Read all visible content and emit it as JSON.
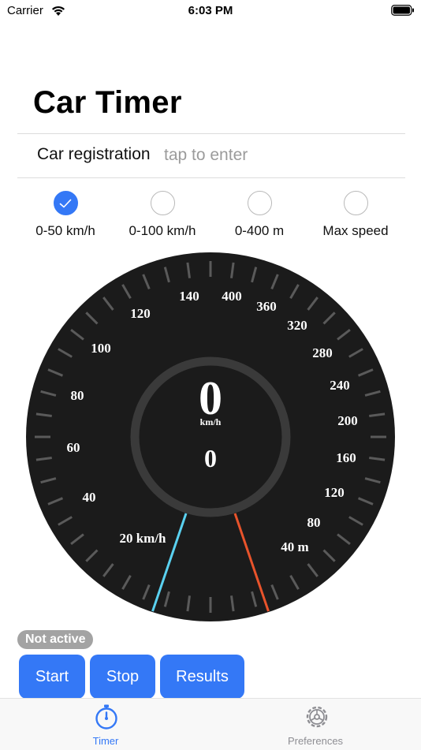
{
  "status_bar": {
    "carrier": "Carrier",
    "time": "6:03 PM"
  },
  "title": "Car Timer",
  "registration": {
    "label": "Car registration",
    "placeholder": "tap to enter",
    "value": ""
  },
  "modes": [
    {
      "label": "0-50 km/h",
      "selected": true
    },
    {
      "label": "0-100 km/h",
      "selected": false
    },
    {
      "label": "0-400 m",
      "selected": false
    },
    {
      "label": "Max speed",
      "selected": false
    }
  ],
  "gauge": {
    "speed_value": "0",
    "speed_unit": "km/h",
    "secondary_value": "0",
    "left_scale": [
      "20 km/h",
      "40",
      "60",
      "80",
      "100",
      "120",
      "140"
    ],
    "right_scale": [
      "400",
      "360",
      "320",
      "280",
      "240",
      "200",
      "160",
      "120",
      "80",
      "40 m"
    ],
    "colors": {
      "face": "#1b1b1b",
      "ring": "#3a3a3a",
      "speed_needle": "#5ad1f0",
      "distance_needle": "#e8532b"
    }
  },
  "status_badge": "Not active",
  "buttons": {
    "start": "Start",
    "stop": "Stop",
    "results": "Results"
  },
  "tabs": [
    {
      "label": "Timer",
      "active": true,
      "icon": "stopwatch-icon"
    },
    {
      "label": "Preferences",
      "active": false,
      "icon": "gear-icon"
    }
  ],
  "accent_color": "#3478f6"
}
